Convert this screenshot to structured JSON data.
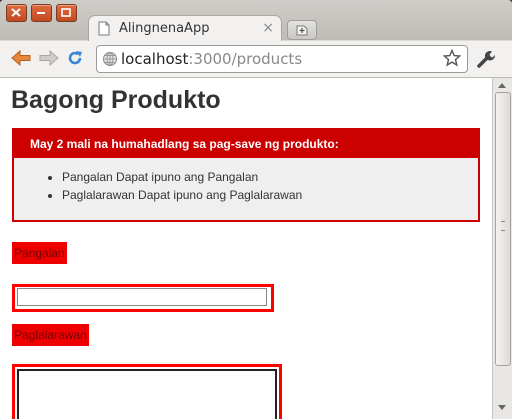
{
  "window": {
    "buttons": [
      "close",
      "minimize",
      "maximize"
    ]
  },
  "tab": {
    "title": "AlingnenaApp",
    "close": "×"
  },
  "address": {
    "host": "localhost",
    "path": ":3000/products"
  },
  "page": {
    "title": "Bagong Produkto",
    "errors": {
      "heading": "May 2 mali na humahadlang sa pag-save ng produkto:",
      "items": [
        "Pangalan Dapat ipuno ang Pangalan",
        "Paglalarawan Dapat ipuno ang Paglalarawan"
      ]
    },
    "fields": {
      "name_label": "Pangalan",
      "name_value": "",
      "description_label": "Paglalarawan",
      "description_value": ""
    }
  },
  "colors": {
    "error_red": "#cc0000",
    "label_red": "#ee0000",
    "window_orange": "#d5582f"
  }
}
